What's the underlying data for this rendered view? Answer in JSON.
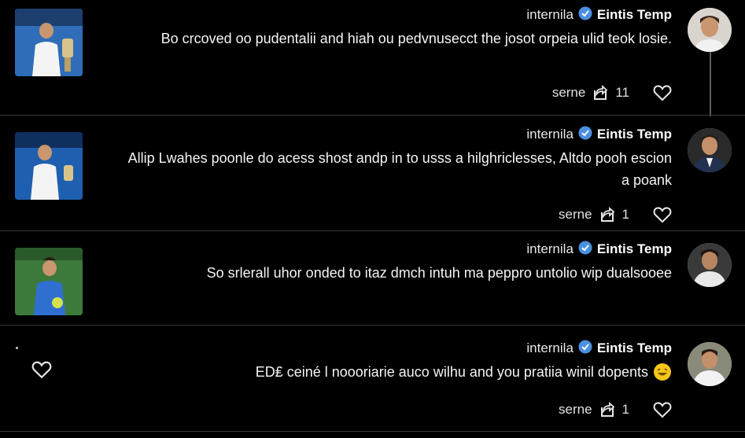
{
  "posts": [
    {
      "author": "Eintis Temp",
      "handle": "internila",
      "text": "Bo crcoved oo pudentalii and hiah ou pedvnusecct the josot orpeia ulid teok losie.",
      "likes": "11",
      "share_label": "serne"
    },
    {
      "author": "Eintis Temp",
      "handle": "internila",
      "text": "Allip Lwahes poonle do acess shost andp in to usss a hilghriclesses, Altdo pooh escion a poank",
      "likes": "1",
      "share_label": "serne"
    },
    {
      "author": "Eintis Temp",
      "handle": "internila",
      "text": "So srlerall uhor onded to itaz dmch intuh ma peppro untolio wip dualsooee",
      "likes": "",
      "share_label": ""
    },
    {
      "author": "Eintis Temp",
      "handle": "internila",
      "text": "ED₤ ceiné l noooriarie auco wilhu and you pratiia winil dopents",
      "likes": "1",
      "share_label": "serne"
    }
  ],
  "icons": {
    "like": "heart-outline-icon",
    "share": "share-icon",
    "verified": "verified-badge-icon",
    "emoji": "laughing-emoji-icon"
  },
  "colors": {
    "background": "#000000",
    "verified": "#4a90e2",
    "emoji": "#f5c518"
  }
}
